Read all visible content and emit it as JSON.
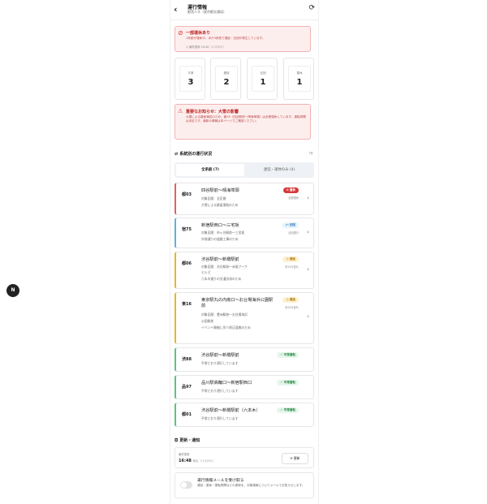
{
  "header": {
    "title": "運行情報",
    "subtitle": "都営バス（東京都交通局）",
    "back": "‹",
    "refresh": "⟳"
  },
  "alert": {
    "icon": "⊘",
    "title": "一部運休あり",
    "desc": "1系統が運休中、ほか3系統で運延・迂回が発生しています。",
    "updated": "◷ 最終更新 16:48（バスロケ）"
  },
  "stats": [
    {
      "label": "平常",
      "value": "3"
    },
    {
      "label": "遅延",
      "value": "2"
    },
    {
      "label": "迂回",
      "value": "1"
    },
    {
      "label": "運休",
      "value": "1"
    }
  ],
  "notice": {
    "icon": "⚠",
    "title": "重要なお知らせ：大雪の影響",
    "desc": "大雪による路面凍結のため、都03（四谷駅前〜晴海埠頭）は全便運休しています。運転再開は未定です。最新の情報は本ページでご確認ください。"
  },
  "routes_section": {
    "icon": "⇄",
    "title": "系統別の運行状況",
    "count": "7件"
  },
  "tabs": [
    {
      "label": "全系統 (7)"
    },
    {
      "label": "遅延・運休のみ (4)"
    }
  ],
  "routes": [
    {
      "code": "都03",
      "name": "四谷駅前〜晴海埠頭",
      "desc1": "対象区間：全区間",
      "desc2": "大雪による路面凍結のため",
      "desc3": "",
      "badge": "⊘ 運休",
      "sub": "全便運休"
    },
    {
      "code": "宿75",
      "name": "新宿駅西口〜三宅坂",
      "desc1": "対象区間：市ヶ谷駅前〜三宅坂",
      "desc2": "外堀通りの道路工事のため",
      "desc3": "",
      "badge": "⤺ 迂回",
      "sub": "迂回運行"
    },
    {
      "code": "都06",
      "name": "渋谷駅前〜新橋駅前",
      "desc1": "対象区間：渋谷駅前〜赤坂アーク",
      "desc2": "ヒルズ",
      "desc3": "六本木通りの交通渋滞のため",
      "badge": "◷ 遅延",
      "sub": "約15分遅れ"
    },
    {
      "code": "東16",
      "name": "東京駅丸の内南口〜お台場海浜公園駅前",
      "desc1": "対象区間：豊洲駅前〜お台場海浜",
      "desc2": "公園駅前",
      "desc3": "イベント開催に伴う周辺混雑のため",
      "badge": "◷ 遅延",
      "sub": "約10分遅れ"
    },
    {
      "code": "渋88",
      "name": "渋谷駅前〜新橋駅前",
      "desc1": "平常どおり運行しています",
      "desc2": "",
      "desc3": "",
      "badge": "✓ 平常運転",
      "sub": ""
    },
    {
      "code": "品97",
      "name": "品川駅高輪口〜新宿駅西口",
      "desc1": "平常どおり運行しています",
      "desc2": "",
      "desc3": "",
      "badge": "✓ 平常運転",
      "sub": ""
    },
    {
      "code": "都01",
      "name": "渋谷駅前〜新橋駅前（六本木）",
      "desc1": "平常どおり運行しています",
      "desc2": "",
      "desc3": "",
      "badge": "✓ 平常運転",
      "sub": ""
    }
  ],
  "update_section": {
    "icon": "◘",
    "title": "更新・通知"
  },
  "update": {
    "label": "最終更新",
    "time": "16:48",
    "time_suffix": "時点（バスロケ）",
    "button": "⟳ 更新"
  },
  "mail": {
    "title": "運行情報メールを受け取る",
    "desc": "遅延・運休・運転再開などの更新を、対象路線についてメールでお知らせします。"
  },
  "float_button": "N"
}
